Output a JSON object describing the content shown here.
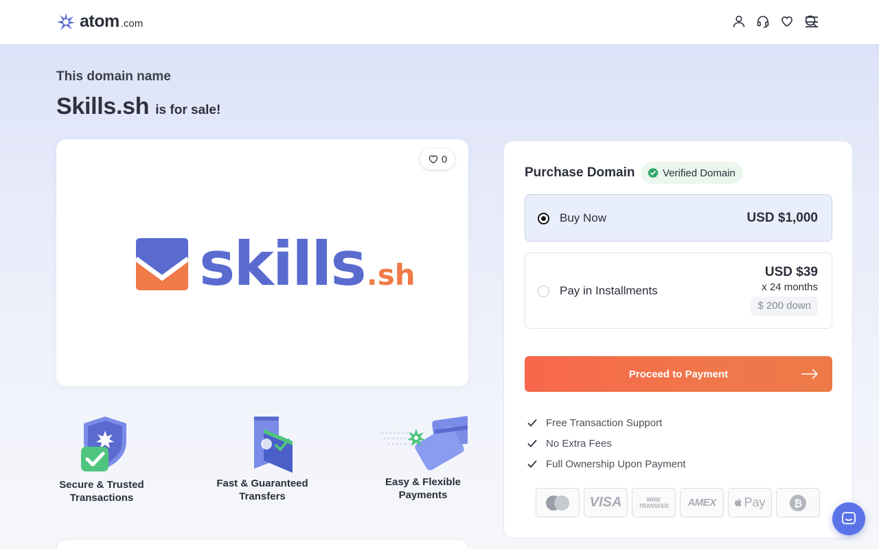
{
  "header": {
    "logo_text": "atom",
    "logo_tld": ".com",
    "icons": [
      "user-icon",
      "headset-icon",
      "heart-icon",
      "search-icon",
      "menu-icon"
    ]
  },
  "hero": {
    "subtitle": "This domain name",
    "domain": "Skills.sh",
    "for_sale": "is for sale!"
  },
  "logo_card": {
    "likes": "0",
    "brand_word": "skills",
    "brand_tld": ".sh",
    "colors": {
      "word": "#5a6bd0",
      "tld": "#f07a48",
      "mark_top": "#5a6bd0",
      "mark_bottom": "#f07a48"
    }
  },
  "features": [
    {
      "label_1": "Secure & Trusted",
      "label_2": "Transactions",
      "icon": "shield-check-icon"
    },
    {
      "label_1": "Fast & Guaranteed",
      "label_2": "Transfers",
      "icon": "transfer-icon"
    },
    {
      "label_1": "Easy & Flexible",
      "label_2": "Payments",
      "icon": "cards-icon"
    }
  ],
  "purchase": {
    "title": "Purchase Domain",
    "verified_label": "Verified Domain",
    "options": {
      "buy_now": {
        "label": "Buy Now",
        "price": "USD $1,000",
        "selected": true
      },
      "installments": {
        "label": "Pay in Installments",
        "price": "USD $39",
        "months": "x 24 months",
        "down": "$ 200 down",
        "selected": false
      }
    },
    "proceed_label": "Proceed to Payment",
    "benefits": [
      "Free Transaction Support",
      "No Extra Fees",
      "Full Ownership Upon Payment"
    ],
    "payment_methods": [
      {
        "name": "mastercard",
        "label": ""
      },
      {
        "name": "visa",
        "label": "VISA"
      },
      {
        "name": "wire-transfer",
        "label": "WIRE TRANSFER"
      },
      {
        "name": "amex",
        "label": "AMEX"
      },
      {
        "name": "apple-pay",
        "label": "Pay"
      },
      {
        "name": "bitcoin",
        "label": ""
      }
    ]
  },
  "colors": {
    "accent": "#f7674b",
    "verified_green": "#2fa86a",
    "chat": "#5a74e8"
  }
}
